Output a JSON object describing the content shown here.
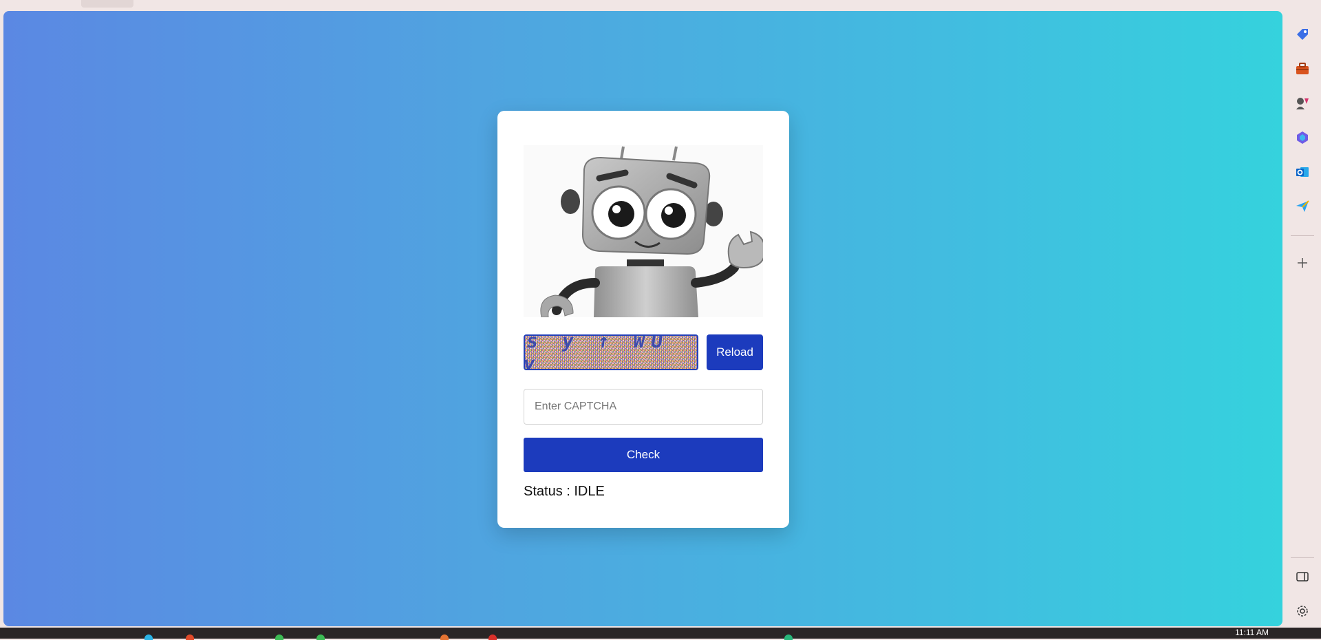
{
  "captcha": {
    "text": "s y ↑ WU y",
    "reload_label": "Reload"
  },
  "input": {
    "placeholder": "Enter CAPTCHA",
    "value": ""
  },
  "check_label": "Check",
  "status": {
    "text": "Status : IDLE"
  },
  "sidebar_icons": [
    "tag-icon",
    "toolbox-icon",
    "games-icon",
    "copilot-icon",
    "outlook-icon",
    "send-icon",
    "add-icon",
    "sidebar-toggle-icon",
    "settings-icon"
  ],
  "taskbar": {
    "clock": "11:11 AM"
  },
  "colors": {
    "accent": "#1c3bbd",
    "gradient_start": "#5b88e3",
    "gradient_end": "#35d2dd"
  }
}
